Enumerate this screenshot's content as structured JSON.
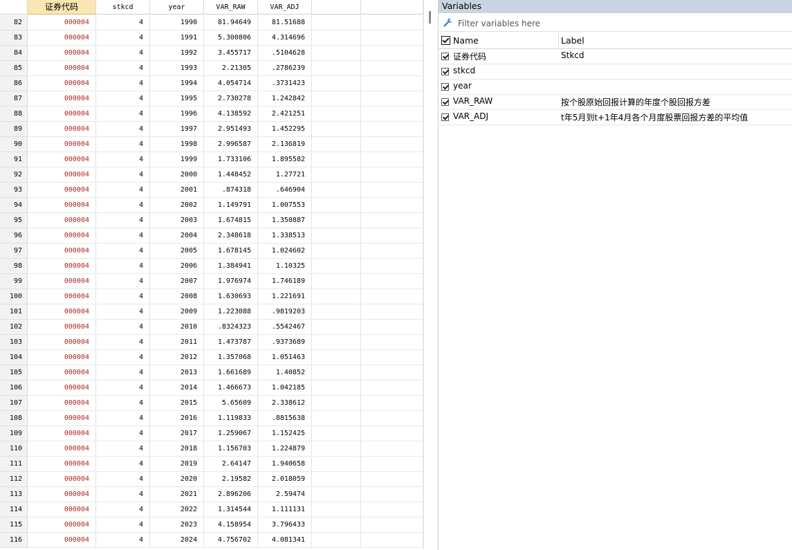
{
  "grid": {
    "columns": [
      "证券代码",
      "stkcd",
      "year",
      "VAR_RAW",
      "VAR_ADJ"
    ],
    "rows": [
      {
        "n": "82",
        "code": "000004",
        "stkcd": "4",
        "year": "1990",
        "var_raw": "81.94649",
        "var_adj": "81.51688"
      },
      {
        "n": "83",
        "code": "000004",
        "stkcd": "4",
        "year": "1991",
        "var_raw": "5.300806",
        "var_adj": "4.314696"
      },
      {
        "n": "84",
        "code": "000004",
        "stkcd": "4",
        "year": "1992",
        "var_raw": "3.455717",
        "var_adj": ".5104628"
      },
      {
        "n": "85",
        "code": "000004",
        "stkcd": "4",
        "year": "1993",
        "var_raw": "2.21305",
        "var_adj": ".2786239"
      },
      {
        "n": "86",
        "code": "000004",
        "stkcd": "4",
        "year": "1994",
        "var_raw": "4.054714",
        "var_adj": ".3731423"
      },
      {
        "n": "87",
        "code": "000004",
        "stkcd": "4",
        "year": "1995",
        "var_raw": "2.730278",
        "var_adj": "1.242842"
      },
      {
        "n": "88",
        "code": "000004",
        "stkcd": "4",
        "year": "1996",
        "var_raw": "4.138592",
        "var_adj": "2.421251"
      },
      {
        "n": "89",
        "code": "000004",
        "stkcd": "4",
        "year": "1997",
        "var_raw": "2.951493",
        "var_adj": "1.452295"
      },
      {
        "n": "90",
        "code": "000004",
        "stkcd": "4",
        "year": "1998",
        "var_raw": "2.996587",
        "var_adj": "2.136819"
      },
      {
        "n": "91",
        "code": "000004",
        "stkcd": "4",
        "year": "1999",
        "var_raw": "1.733106",
        "var_adj": "1.895582"
      },
      {
        "n": "92",
        "code": "000004",
        "stkcd": "4",
        "year": "2000",
        "var_raw": "1.448452",
        "var_adj": "1.27721"
      },
      {
        "n": "93",
        "code": "000004",
        "stkcd": "4",
        "year": "2001",
        "var_raw": ".874318",
        "var_adj": ".646904"
      },
      {
        "n": "94",
        "code": "000004",
        "stkcd": "4",
        "year": "2002",
        "var_raw": "1.149791",
        "var_adj": "1.007553"
      },
      {
        "n": "95",
        "code": "000004",
        "stkcd": "4",
        "year": "2003",
        "var_raw": "1.674815",
        "var_adj": "1.350887"
      },
      {
        "n": "96",
        "code": "000004",
        "stkcd": "4",
        "year": "2004",
        "var_raw": "2.348618",
        "var_adj": "1.338513"
      },
      {
        "n": "97",
        "code": "000004",
        "stkcd": "4",
        "year": "2005",
        "var_raw": "1.678145",
        "var_adj": "1.024602"
      },
      {
        "n": "98",
        "code": "000004",
        "stkcd": "4",
        "year": "2006",
        "var_raw": "1.384941",
        "var_adj": "1.10325"
      },
      {
        "n": "99",
        "code": "000004",
        "stkcd": "4",
        "year": "2007",
        "var_raw": "1.976974",
        "var_adj": "1.746189"
      },
      {
        "n": "100",
        "code": "000004",
        "stkcd": "4",
        "year": "2008",
        "var_raw": "1.630693",
        "var_adj": "1.221691"
      },
      {
        "n": "101",
        "code": "000004",
        "stkcd": "4",
        "year": "2009",
        "var_raw": "1.223088",
        "var_adj": ".9819203"
      },
      {
        "n": "102",
        "code": "000004",
        "stkcd": "4",
        "year": "2010",
        "var_raw": ".8324323",
        "var_adj": ".5542467"
      },
      {
        "n": "103",
        "code": "000004",
        "stkcd": "4",
        "year": "2011",
        "var_raw": "1.473787",
        "var_adj": ".9373689"
      },
      {
        "n": "104",
        "code": "000004",
        "stkcd": "4",
        "year": "2012",
        "var_raw": "1.357068",
        "var_adj": "1.051463"
      },
      {
        "n": "105",
        "code": "000004",
        "stkcd": "4",
        "year": "2013",
        "var_raw": "1.661689",
        "var_adj": "1.40852"
      },
      {
        "n": "106",
        "code": "000004",
        "stkcd": "4",
        "year": "2014",
        "var_raw": "1.466673",
        "var_adj": "1.042185"
      },
      {
        "n": "107",
        "code": "000004",
        "stkcd": "4",
        "year": "2015",
        "var_raw": "5.65609",
        "var_adj": "2.338612"
      },
      {
        "n": "108",
        "code": "000004",
        "stkcd": "4",
        "year": "2016",
        "var_raw": "1.119833",
        "var_adj": ".8815638"
      },
      {
        "n": "109",
        "code": "000004",
        "stkcd": "4",
        "year": "2017",
        "var_raw": "1.259067",
        "var_adj": "1.152425"
      },
      {
        "n": "110",
        "code": "000004",
        "stkcd": "4",
        "year": "2018",
        "var_raw": "1.156703",
        "var_adj": "1.224879"
      },
      {
        "n": "111",
        "code": "000004",
        "stkcd": "4",
        "year": "2019",
        "var_raw": "2.64147",
        "var_adj": "1.940658"
      },
      {
        "n": "112",
        "code": "000004",
        "stkcd": "4",
        "year": "2020",
        "var_raw": "2.19582",
        "var_adj": "2.018059"
      },
      {
        "n": "113",
        "code": "000004",
        "stkcd": "4",
        "year": "2021",
        "var_raw": "2.896206",
        "var_adj": "2.59474"
      },
      {
        "n": "114",
        "code": "000004",
        "stkcd": "4",
        "year": "2022",
        "var_raw": "1.314544",
        "var_adj": "1.111131"
      },
      {
        "n": "115",
        "code": "000004",
        "stkcd": "4",
        "year": "2023",
        "var_raw": "4.158954",
        "var_adj": "3.796433"
      },
      {
        "n": "116",
        "code": "000004",
        "stkcd": "4",
        "year": "2024",
        "var_raw": "4.756702",
        "var_adj": "4.081341"
      }
    ]
  },
  "variables": {
    "title": "Variables",
    "filter_placeholder": "Filter variables here",
    "header": {
      "name": "Name",
      "label": "Label"
    },
    "items": [
      {
        "name": "证券代码",
        "label": "Stkcd",
        "checked": true
      },
      {
        "name": "stkcd",
        "label": "",
        "checked": true
      },
      {
        "name": "year",
        "label": "",
        "checked": true
      },
      {
        "name": "VAR_RAW",
        "label": "按个股原始回报计算的年度个股回报方差",
        "checked": true
      },
      {
        "name": "VAR_ADJ",
        "label": "t年5月到t+1年4月各个月度股票回报方差的平均值",
        "checked": true
      }
    ]
  },
  "colors": {
    "code_text": "#b22222",
    "selected_header": "#fbe6b3",
    "panel_title_bg": "#c8d4e2"
  },
  "icons": {
    "filter": "wrench-icon",
    "checkbox": "checkbox-checked-icon"
  }
}
